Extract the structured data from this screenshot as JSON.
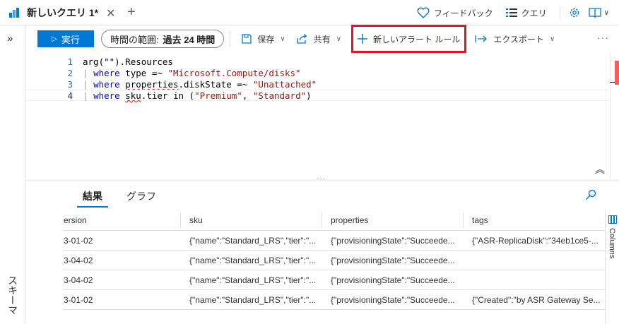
{
  "tab": {
    "title": "新しいクエリ 1*",
    "close": "✕",
    "add": "+"
  },
  "top_right": {
    "feedback": "フィードバック",
    "queries": "クエリ"
  },
  "rail": {
    "toggle": "»",
    "label": "スキーマ"
  },
  "toolbar": {
    "run": "実行",
    "time_range_label": "時間の範囲:",
    "time_range_value": "過去 24 時間",
    "save": "保存",
    "share": "共有",
    "new_alert_rule": "新しいアラート ルール",
    "export": "エクスポート",
    "more": "···"
  },
  "editor": {
    "lines": [
      {
        "num": "1"
      },
      {
        "num": "2"
      },
      {
        "num": "3"
      },
      {
        "num": "4"
      }
    ],
    "tokens": {
      "l1": "arg(\"\").Resources",
      "pipe": "| ",
      "where": "where",
      "l2_a": " type =~ ",
      "l2_str": "\"Microsoft.Compute/disks\"",
      "l3_sq": "properties",
      "l3_a": ".diskState =~ ",
      "l3_str": "\"Unattached\"",
      "l4_sq": "sku",
      "l4_a": ".tier in (",
      "l4_str1": "\"Premium\"",
      "l4_comma": ", ",
      "l4_str2": "\"Standard\"",
      "l4_close": ")",
      "space": " "
    }
  },
  "results": {
    "tab_results": "結果",
    "tab_chart": "グラフ",
    "columns_label": "Columns",
    "headers": [
      "ersion",
      "sku",
      "properties",
      "tags"
    ],
    "rows": [
      [
        "3-01-02",
        "{\"name\":\"Standard_LRS\",\"tier\":\"...",
        "{\"provisioningState\":\"Succeede...",
        "{\"ASR-ReplicaDisk\":\"34eb1ce5-..."
      ],
      [
        "3-04-02",
        "{\"name\":\"Standard_LRS\",\"tier\":\"...",
        "{\"provisioningState\":\"Succeede...",
        ""
      ],
      [
        "3-04-02",
        "{\"name\":\"Standard_LRS\",\"tier\":\"...",
        "{\"provisioningState\":\"Succeede...",
        ""
      ],
      [
        "3-01-02",
        "{\"name\":\"Standard_LRS\",\"tier\":\"...",
        "{\"provisioningState\":\"Succeede...",
        "{\"Created\":\"by ASR Gateway Se..."
      ]
    ]
  },
  "colors": {
    "accent": "#0078d4",
    "highlight": "#e81123",
    "keyword": "#0000ff",
    "string": "#a31515"
  }
}
